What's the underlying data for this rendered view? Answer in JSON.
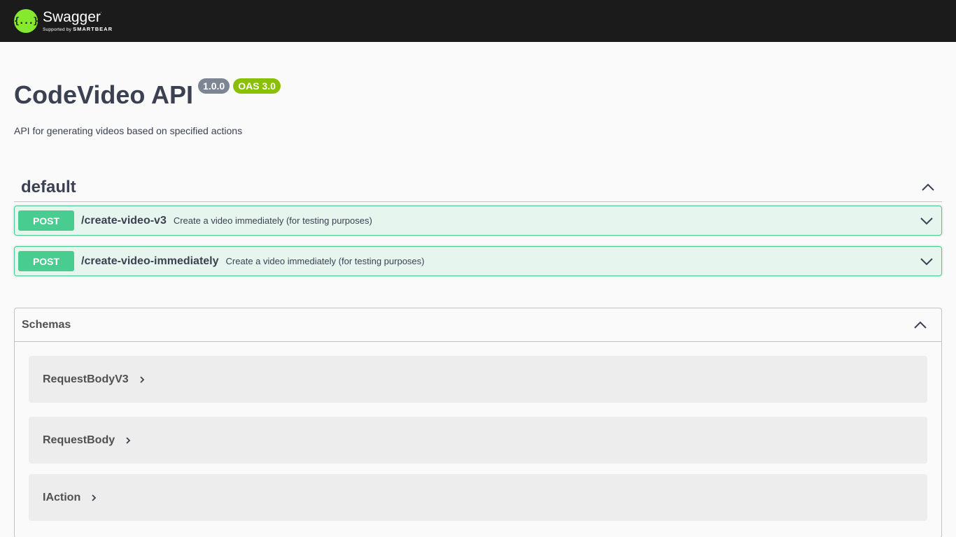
{
  "topbar": {
    "logo_symbol": "{...}",
    "logo_name": "Swagger",
    "logo_sub_prefix": "Supported by",
    "logo_sub_brand": "SMARTBEAR"
  },
  "info": {
    "title": "CodeVideo API",
    "version": "1.0.0",
    "oas": "OAS 3.0",
    "description": "API for generating videos based on specified actions"
  },
  "tag": {
    "name": "default",
    "operations": [
      {
        "method": "POST",
        "path": "/create-video-v3",
        "summary": "Create a video immediately (for testing purposes)"
      },
      {
        "method": "POST",
        "path": "/create-video-immediately",
        "summary": "Create a video immediately (for testing purposes)"
      }
    ]
  },
  "schemas": {
    "title": "Schemas",
    "items": [
      "RequestBodyV3",
      "RequestBody",
      "IAction"
    ]
  },
  "colors": {
    "post": "#49cc90",
    "version_badge": "#7d8492",
    "oas_badge": "#89bf04",
    "logo": "#85ea2d"
  }
}
